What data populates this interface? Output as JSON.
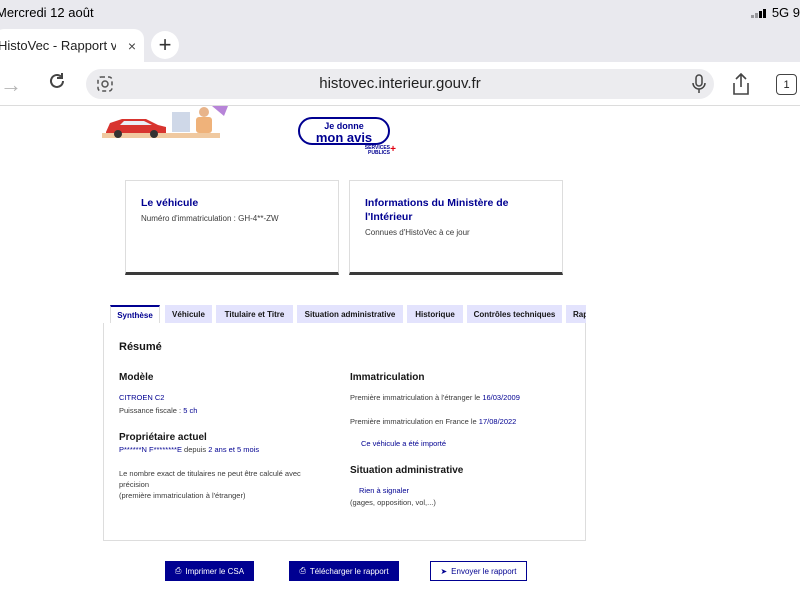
{
  "status_bar": {
    "date": "Mercredi 12 août",
    "network": "5G 9"
  },
  "browser": {
    "tab_title": "HistoVec - Rapport vendeur",
    "tab_close": "×",
    "new_tab": "+",
    "url": "histovec.interieur.gouv.fr",
    "tab_count": "1"
  },
  "feedback": {
    "line1": "Je donne",
    "line2": "mon avis",
    "logo_l1": "SERVICES",
    "logo_l2": "PUBLICS",
    "logo_plus": "+"
  },
  "cards": {
    "vehicle": {
      "title": "Le véhicule",
      "subtitle": "Numéro d'immatriculation : GH-4**-ZW"
    },
    "ministry": {
      "title": "Informations du Ministère de l'Intérieur",
      "subtitle": "Connues d'HistoVec à ce jour"
    }
  },
  "tabs": [
    {
      "label": "Synthèse",
      "active": true
    },
    {
      "label": "Véhicule"
    },
    {
      "label": "Titulaire et Titre"
    },
    {
      "label": "Situation administrative"
    },
    {
      "label": "Historique"
    },
    {
      "label": "Contrôles techniques"
    },
    {
      "label": "Rapport"
    }
  ],
  "summary": {
    "heading": "Résumé",
    "model": {
      "heading": "Modèle",
      "name": "CITROEN C2",
      "power_label": "Puissance fiscale : ",
      "power_value": "5 ch"
    },
    "owner": {
      "heading": "Propriétaire actuel",
      "name": "P******N F********E",
      "since_label": " depuis ",
      "since_value": "2 ans et 5 mois",
      "note_line1": "Le nombre exact de titulaires ne peut être calculé avec",
      "note_line2": "précision",
      "note_line3": "(première immatriculation à l'étranger)"
    },
    "registration": {
      "heading": "Immatriculation",
      "foreign_label": "Première immatriculation à l'étranger le ",
      "foreign_date": "16/03/2009",
      "france_label": "Première immatriculation en France le ",
      "france_date": "17/08/2022",
      "imported": "Ce véhicule a été importé"
    },
    "admin": {
      "heading": "Situation administrative",
      "status": "Rien à signaler",
      "detail": "(gages, opposition, vol,...)"
    }
  },
  "actions": {
    "print": "Imprimer le CSA",
    "download": "Télécharger le rapport",
    "send": "Envoyer le rapport"
  },
  "colors": {
    "brand_blue": "#000091",
    "tab_bg": "#e3e3fd",
    "accent_red": "#e1000f"
  }
}
